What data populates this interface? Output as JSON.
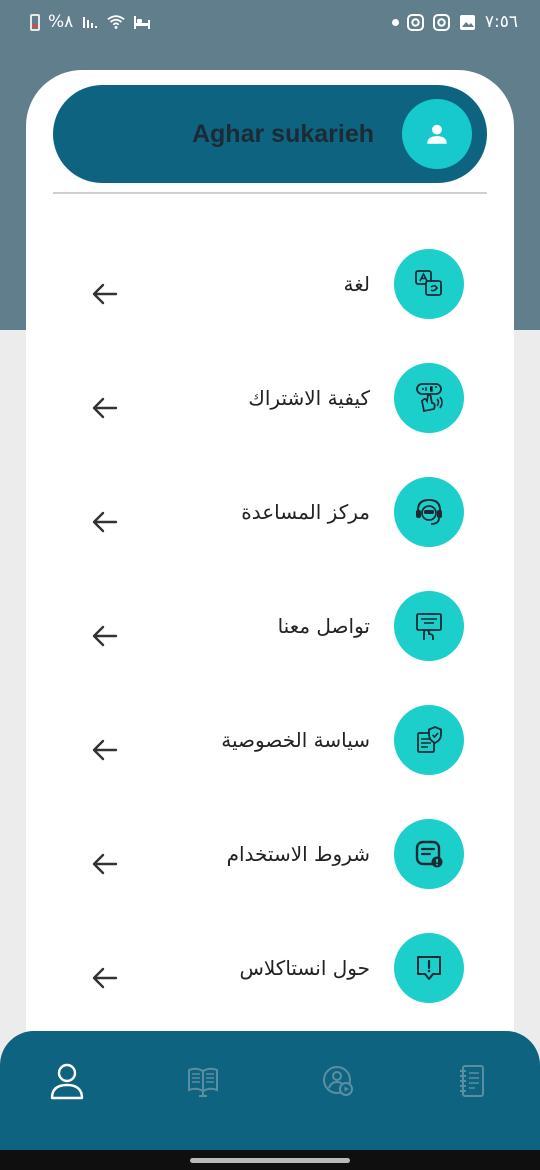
{
  "status_bar": {
    "battery_text": "%٨",
    "time": "٧:٥٦",
    "icons_left": [
      "battery-icon",
      "signal-icon",
      "wifi-icon",
      "sleep-icon"
    ],
    "icons_right": [
      "notification-dot",
      "instagram-icon",
      "instagram-icon",
      "image-icon"
    ]
  },
  "profile": {
    "name": "Aghar sukarieh",
    "avatar_icon": "person-icon"
  },
  "menu": {
    "items": [
      {
        "label": "لغة",
        "icon": "language-icon"
      },
      {
        "label": "كيفية الاشتراك",
        "icon": "subscribe-icon"
      },
      {
        "label": "مركز المساعدة",
        "icon": "headset-icon"
      },
      {
        "label": "تواصل معنا",
        "icon": "contact-us-icon"
      },
      {
        "label": "سياسة الخصوصية",
        "icon": "privacy-icon"
      },
      {
        "label": "شروط الاستخدام",
        "icon": "terms-icon"
      },
      {
        "label": "حول انستاكلاس",
        "icon": "about-icon"
      }
    ],
    "arrow_icon": "arrow-left-icon"
  },
  "bottom_nav": {
    "tabs": [
      {
        "name": "profile",
        "icon": "person-outline-icon",
        "active": true
      },
      {
        "name": "library",
        "icon": "book-icon",
        "active": false
      },
      {
        "name": "video",
        "icon": "video-person-icon",
        "active": false
      },
      {
        "name": "notes",
        "icon": "notebook-icon",
        "active": false
      }
    ]
  },
  "colors": {
    "primary": "#0e6480",
    "accent": "#1ccfcb",
    "header_bg": "#617e8d",
    "page_bg": "#ececec"
  }
}
